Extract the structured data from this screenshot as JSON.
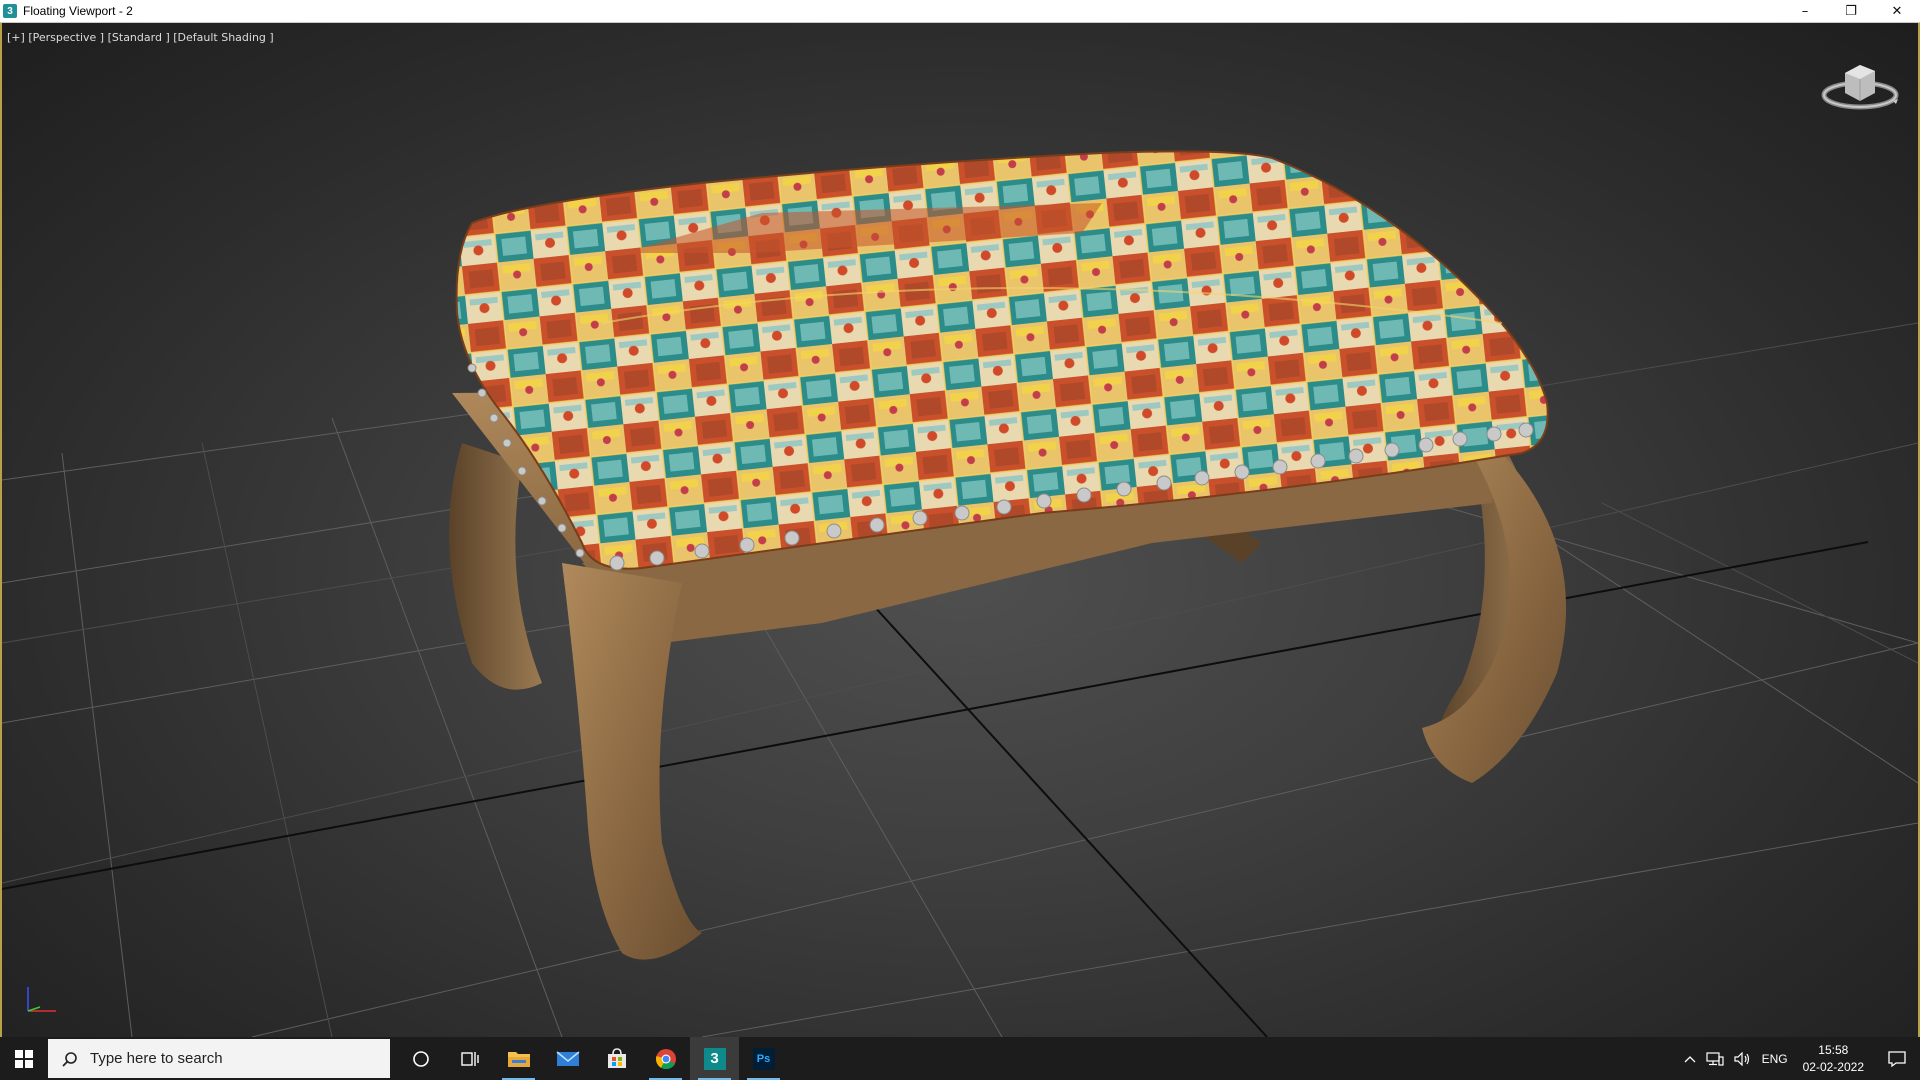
{
  "window": {
    "title": "Floating Viewport - 2",
    "app_icon_glyph": "3",
    "controls": {
      "minimize": "–",
      "restore": "❐",
      "close": "✕"
    }
  },
  "viewport": {
    "label_plus": "[+]",
    "label_view": "[Perspective ]",
    "label_shading_mode": "[Standard ]",
    "label_shading": "[Default Shading ]",
    "viewcube_icon": "viewcube-icon",
    "axis_icon": "axis-tripod-icon"
  },
  "taskbar": {
    "search_placeholder": "Type here to search",
    "icons": [
      "windows-start-icon",
      "cortana-icon",
      "task-view-icon",
      "file-explorer-icon",
      "mail-icon",
      "store-icon",
      "chrome-icon",
      "3dsmax-icon",
      "photoshop-icon"
    ],
    "max_label": "3",
    "ps_label": "Ps",
    "language": "ENG",
    "time": "15:58",
    "date": "02-02-2022"
  },
  "colors": {
    "viewport_border": "#b7a248",
    "taskbar_bg": "#1c1c1c",
    "active_underline": "#76b9ed"
  }
}
